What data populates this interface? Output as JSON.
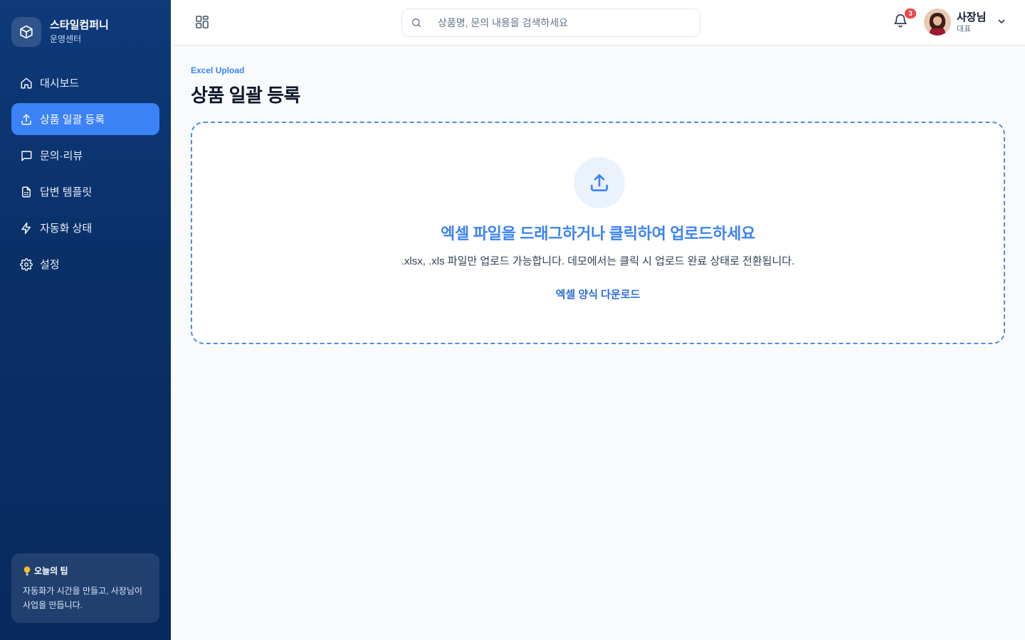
{
  "brand": {
    "name": "스타일컴퍼니",
    "subtitle": "운영센터"
  },
  "sidebar": {
    "items": [
      {
        "label": "대시보드",
        "icon": "home-icon",
        "active": false
      },
      {
        "label": "상품 일괄 등록",
        "icon": "upload-icon",
        "active": true
      },
      {
        "label": "문의·리뷰",
        "icon": "message-icon",
        "active": false
      },
      {
        "label": "답변 템플릿",
        "icon": "document-icon",
        "active": false
      },
      {
        "label": "자동화 상태",
        "icon": "lightning-icon",
        "active": false
      },
      {
        "label": "설정",
        "icon": "gear-icon",
        "active": false
      }
    ],
    "tip": {
      "title": "오늘의 팁",
      "body": "자동화가 시간을 만들고, 사장님이 사업을 만듭니다."
    }
  },
  "header": {
    "search_placeholder": "상품명, 문의 내용을 검색하세요",
    "notification_count": "3",
    "user": {
      "name": "사장님",
      "role": "대표"
    }
  },
  "main": {
    "eyebrow": "Excel Upload",
    "title": "상품 일괄 등록",
    "dropzone": {
      "title": "엑셀 파일을 드래그하거나 클릭하여 업로드하세요",
      "description": ".xlsx, .xls 파일만 업로드 가능합니다. 데모에서는 클릭 시 업로드 완료 상태로 전환됩니다.",
      "template_link": "엑셀 양식 다운로드"
    }
  },
  "colors": {
    "accent": "#3b82f6",
    "sidebar_bg": "#0a3068",
    "badge": "#ef4444"
  }
}
